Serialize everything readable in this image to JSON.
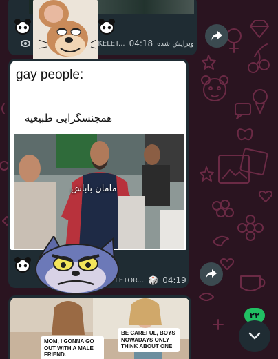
{
  "messages": [
    {
      "id": "msg-1",
      "edited_label": "ویرایش شده",
      "time": "04:18",
      "sender_truncated": "SKELET...",
      "view_icon": "eye-icon",
      "emojis": [
        "panda-face",
        "panda-face"
      ]
    },
    {
      "id": "msg-2",
      "caption_en": "gay people:",
      "caption_fa": "همجنسگرایی طبیعیه",
      "photo_overlay_text": "مامان باباش",
      "time": "04:19",
      "sender_truncated": "SKELETOR...",
      "emojis": [
        "panda-face",
        "panda-face"
      ]
    },
    {
      "id": "msg-3",
      "meme_left_text": "MOM, I GONNA GO OUT WITH A MALE FRIEND.",
      "meme_right_text": "BE CAREFUL, BOYS NOWADAYS ONLY THINK ABOUT ONE"
    }
  ],
  "unread_badge": "۲۲",
  "icons": {
    "forward": "forward-arrow-icon",
    "scroll_down": "chevron-down-icon"
  },
  "colors": {
    "wallpaper": "#2a1420",
    "doodle": "#6b2a45",
    "bubble": "#1f2c33",
    "badge": "#21c063",
    "meta_text": "#c7ced1"
  }
}
